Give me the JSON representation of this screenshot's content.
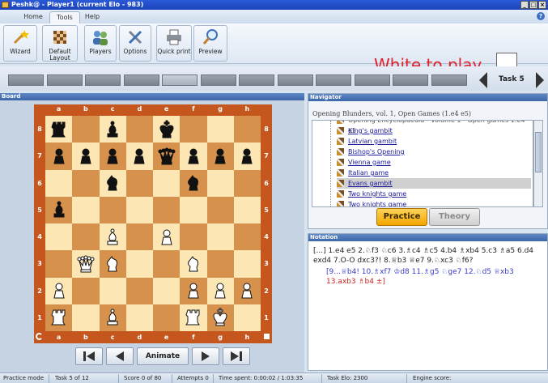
{
  "window": {
    "title": "Peshk@ - Player1 (current Elo - 983)",
    "controls": [
      "_",
      "□",
      "×"
    ]
  },
  "menu": {
    "tabs": [
      "Home",
      "Tools",
      "Help"
    ],
    "active": "Tools",
    "help_icon": "?"
  },
  "ribbon": {
    "buttons": [
      {
        "label": "Wizard",
        "icon": "wand-icon"
      },
      {
        "label": "Default Layout",
        "icon": "board-layout-icon"
      },
      {
        "label": "Players",
        "icon": "players-icon"
      },
      {
        "label": "Options",
        "icon": "wrench-icon"
      },
      {
        "label": "Quick print",
        "icon": "printer-icon"
      },
      {
        "label": "Preview",
        "icon": "magnifier-icon"
      }
    ],
    "turn_text": "White to play"
  },
  "task_nav": {
    "label": "Task 5",
    "segments": 12,
    "current_segment": 5
  },
  "board_panel": {
    "title": "Board",
    "files": [
      "a",
      "b",
      "c",
      "d",
      "e",
      "f",
      "g",
      "h"
    ],
    "ranks": [
      "8",
      "7",
      "6",
      "5",
      "4",
      "3",
      "2",
      "1"
    ],
    "pieces": [
      {
        "sq": "a8",
        "p": "bR"
      },
      {
        "sq": "c8",
        "p": "bB"
      },
      {
        "sq": "e8",
        "p": "bK"
      },
      {
        "sq": "a7",
        "p": "bP"
      },
      {
        "sq": "b7",
        "p": "bP"
      },
      {
        "sq": "c7",
        "p": "bP"
      },
      {
        "sq": "d7",
        "p": "bP"
      },
      {
        "sq": "e7",
        "p": "bQ"
      },
      {
        "sq": "f7",
        "p": "bP"
      },
      {
        "sq": "g7",
        "p": "bP"
      },
      {
        "sq": "h7",
        "p": "bP"
      },
      {
        "sq": "c6",
        "p": "bN"
      },
      {
        "sq": "f6",
        "p": "bN"
      },
      {
        "sq": "a5",
        "p": "bB"
      },
      {
        "sq": "c4",
        "p": "wB"
      },
      {
        "sq": "e4",
        "p": "wP"
      },
      {
        "sq": "b3",
        "p": "wQ"
      },
      {
        "sq": "c3",
        "p": "wN"
      },
      {
        "sq": "f3",
        "p": "wN"
      },
      {
        "sq": "a2",
        "p": "wP"
      },
      {
        "sq": "f2",
        "p": "wP"
      },
      {
        "sq": "g2",
        "p": "wP"
      },
      {
        "sq": "h2",
        "p": "wP"
      },
      {
        "sq": "a1",
        "p": "wR"
      },
      {
        "sq": "c1",
        "p": "wB"
      },
      {
        "sq": "f1",
        "p": "wR"
      },
      {
        "sq": "g1",
        "p": "wK"
      }
    ],
    "controls": {
      "first": "first-move-icon",
      "prev": "prev-move-icon",
      "animate": "Animate",
      "next": "next-move-icon",
      "last": "last-move-icon"
    }
  },
  "navigator": {
    "title": "Navigator",
    "subtitle": "Opening Blunders, vol. 1, Open Games (1.e4 e5)",
    "items": [
      "Opening Encyclopaedia - Volume 1 - Open games 1.e4 e5",
      "King's gambit",
      "Latvian gambit",
      "Bishop's Opening",
      "Vienna game",
      "Italian game",
      "Evans gambit",
      "Two knights game",
      "Two knights game"
    ],
    "selected": "Evans gambit",
    "practice_label": "Practice",
    "theory_label": "Theory"
  },
  "notation": {
    "title": "Notation",
    "main_line": "[...] 1.e4 e5 2.♘f3 ♘c6 3.♗c4 ♗c5 4.b4 ♗xb4 5.c3 ♗a5 6.d4 exd4 7.O-O dxc3?! 8.♕b3 ♕e7 9.♘xc3 ♘f6?",
    "variation_prefix": "[9...♕b4! 10.♗xf7 ♔d8 11.♗g5 ♘ge7 12.♘d5 ♕xb3",
    "variation_rest": "13.axb3 ♗b4 ±]"
  },
  "status": {
    "mode": "Practice mode",
    "task": "Task 5 of 12",
    "score": "Score 0 of 80",
    "attempts": "Attempts 0",
    "time": "Time spent: 0:00:02 / 1:03:35",
    "task_elo": "Task Elo: 2300",
    "engine": "Engine score:"
  }
}
